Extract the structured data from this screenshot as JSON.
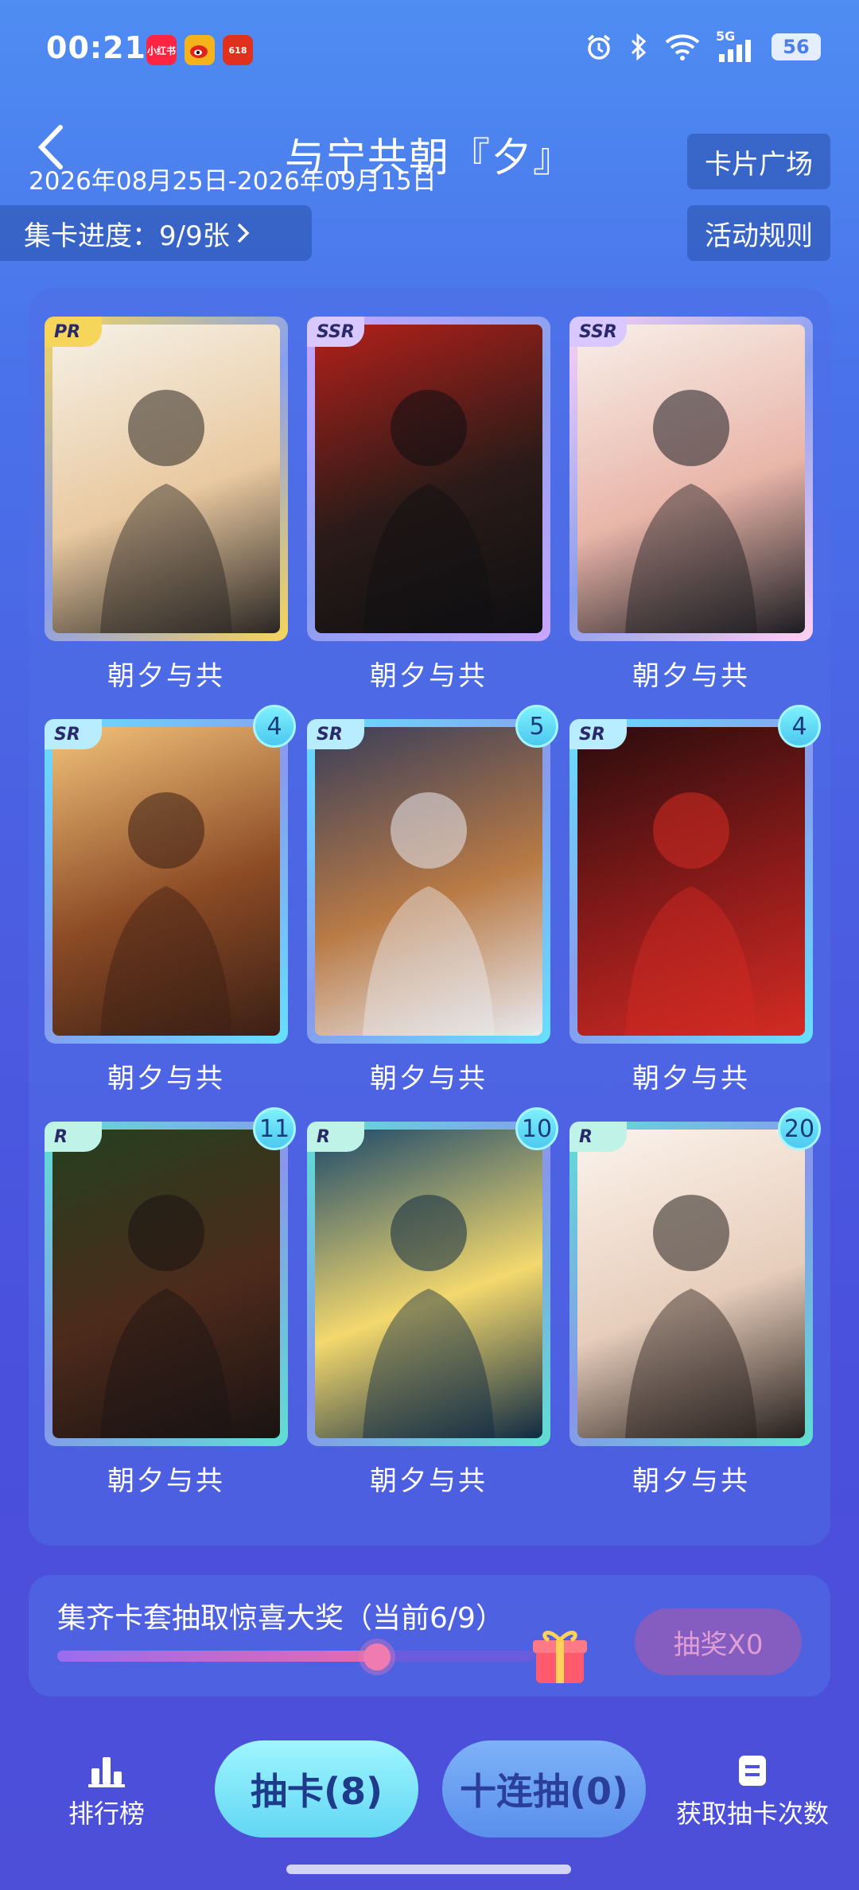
{
  "status_bar": {
    "time": "00:21",
    "apps": [
      {
        "icon": "xiaohongshu-icon",
        "label": "小红书",
        "color": "#ff2442"
      },
      {
        "icon": "weibo-icon",
        "label": "",
        "color": "#f5b31b"
      },
      {
        "icon": "event-icon",
        "label": "618",
        "color": "#e0301e"
      }
    ],
    "network": "5G",
    "battery": "56"
  },
  "header": {
    "title": "与宁共朝『夕』",
    "date_range": "2026年08月25日-2026年09月15日",
    "card_square_button": "卡片广场",
    "progress_label": "集卡进度：9/9张",
    "rules_button": "活动规则"
  },
  "cards": [
    {
      "rarity": "PR",
      "name": "朝夕与共",
      "count": "",
      "frame": "#f6d65a",
      "colors": [
        "#f5f1e7",
        "#e9c9a0",
        "#2b2623"
      ]
    },
    {
      "rarity": "SSR",
      "name": "朝夕与共",
      "count": "",
      "frame": "#c9a7ff",
      "colors": [
        "#b3201a",
        "#2a1b18",
        "#0f0f12"
      ]
    },
    {
      "rarity": "SSR",
      "name": "朝夕与共",
      "count": "",
      "frame": "#ffd1f0",
      "colors": [
        "#f7efe9",
        "#e9b5a9",
        "#1c1c22"
      ]
    },
    {
      "rarity": "SR",
      "name": "朝夕与共",
      "count": "4",
      "frame": "#66e1ff",
      "colors": [
        "#f2c27a",
        "#8c4b25",
        "#3b1f15"
      ]
    },
    {
      "rarity": "SR",
      "name": "朝夕与共",
      "count": "5",
      "frame": "#66e1ff",
      "colors": [
        "#3a3f5a",
        "#b97a45",
        "#e9eaf0"
      ]
    },
    {
      "rarity": "SR",
      "name": "朝夕与共",
      "count": "4",
      "frame": "#66e1ff",
      "colors": [
        "#2a0c0d",
        "#8c1b1a",
        "#d32b23"
      ]
    },
    {
      "rarity": "R",
      "name": "朝夕与共",
      "count": "11",
      "frame": "#5fe0d2",
      "colors": [
        "#24401f",
        "#4d2a1b",
        "#1a1313"
      ]
    },
    {
      "rarity": "R",
      "name": "朝夕与共",
      "count": "10",
      "frame": "#5fe0d2",
      "colors": [
        "#1d4a6a",
        "#f3d86d",
        "#0f2a44"
      ]
    },
    {
      "rarity": "R",
      "name": "朝夕与共",
      "count": "20",
      "frame": "#5fe0d2",
      "colors": [
        "#fbf3ec",
        "#e7cdbb",
        "#27201d"
      ]
    }
  ],
  "lottery": {
    "text": "集齐卡套抽取惊喜大奖（当前6/9）",
    "progress": 0.67,
    "button": "抽奖X0"
  },
  "bottom_nav": {
    "ranking": "排行榜",
    "draw": "抽卡(8)",
    "ten_draw": "十连抽(0)",
    "get_draws": "获取抽卡次数"
  },
  "colors": {
    "accent_cyan": "#7ee9f5",
    "accent_blue": "#6a97ef"
  }
}
